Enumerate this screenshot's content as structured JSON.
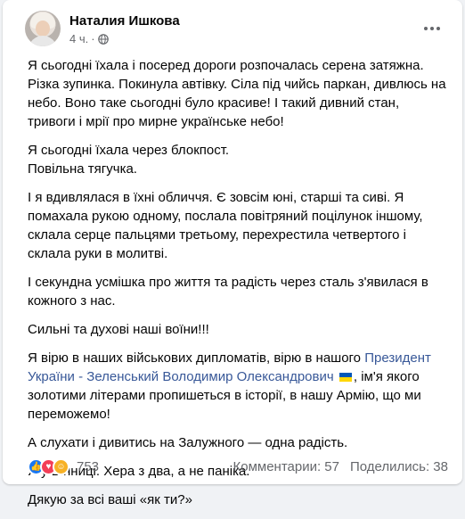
{
  "post": {
    "author": "Наталия Ишкова",
    "time": "4 ч.",
    "visibility_icon": "globe-icon",
    "menu_icon": "more-options-icon"
  },
  "content": {
    "p1": "Я сьогодні їхала і посеред дороги розпочалась серена затяжна. Різка зупинка. Покинула автівку. Сіла під чийсь паркан, дивлюсь на небо. Воно таке сьогодні було красиве! І такий дивний стан, тривоги і мрії про мирне українське небо!",
    "p2_line1": "Я сьогодні їхала через блокпост.",
    "p2_line2": "Повільна тягучка.",
    "p3": "І я вдивлялася в їхні обличчя. Є зовсім юні, старші та сиві. Я помахала рукою одному, послала повітряний поцілунок іншому, склала серце пальцями третьому, перехрестила четвертого і склала руки в молитві.",
    "p4": "І секундна усмішка про життя та радість через сталь з'явилася в кожного з нас.",
    "p5": "Сильні та духові наші воїни!!!",
    "p6_before": "Я вірю в наших військових дипломатів, вірю в нашого",
    "p6_link": "Президент України - Зеленський Володимир Олександрович",
    "p6_after": ", ім'я якого золотими літерами пропишеться в історії, в нашу Армію, що ми переможемо!",
    "p7": "А слухати і дивитись на Залужного — одна радість.",
    "p8": "Я у Вінниці. Хера з два, а не паніка.",
    "p9": "Дякую за всі ваші «як ти?»"
  },
  "footer": {
    "reaction_count": "753",
    "comments": "Комментарии: 57",
    "shares": "Поделились: 38"
  },
  "colors": {
    "link": "#385898",
    "like": "#1877f2",
    "love": "#f33e58",
    "care": "#f7b125"
  }
}
